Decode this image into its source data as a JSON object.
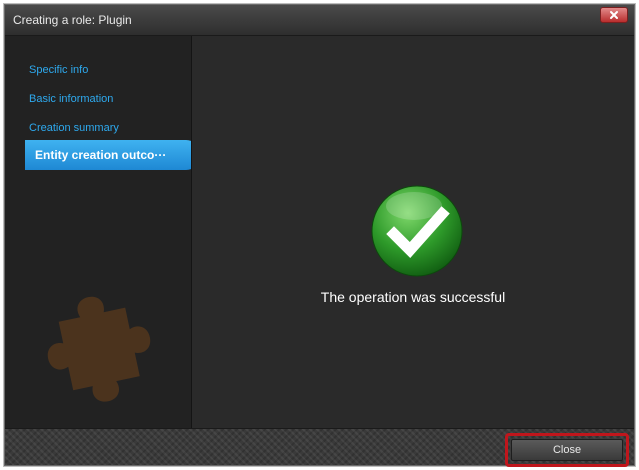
{
  "window": {
    "title": "Creating a role: Plugin"
  },
  "sidebar": {
    "items": [
      {
        "label": "Specific info",
        "active": false
      },
      {
        "label": "Basic information",
        "active": false
      },
      {
        "label": "Creation summary",
        "active": false
      },
      {
        "label": "Entity creation outco···",
        "active": true
      }
    ],
    "decoration_icon": "puzzle-piece-icon"
  },
  "main": {
    "status_icon": "checkmark-icon",
    "status_message": "The operation was successful"
  },
  "footer": {
    "close_label": "Close"
  },
  "colors": {
    "accent_blue": "#2ea9ee",
    "active_tab": "#1e88d4",
    "success_green": "#2e9a2a",
    "highlight_red": "#c0161c",
    "window_close": "#b92d2d"
  }
}
